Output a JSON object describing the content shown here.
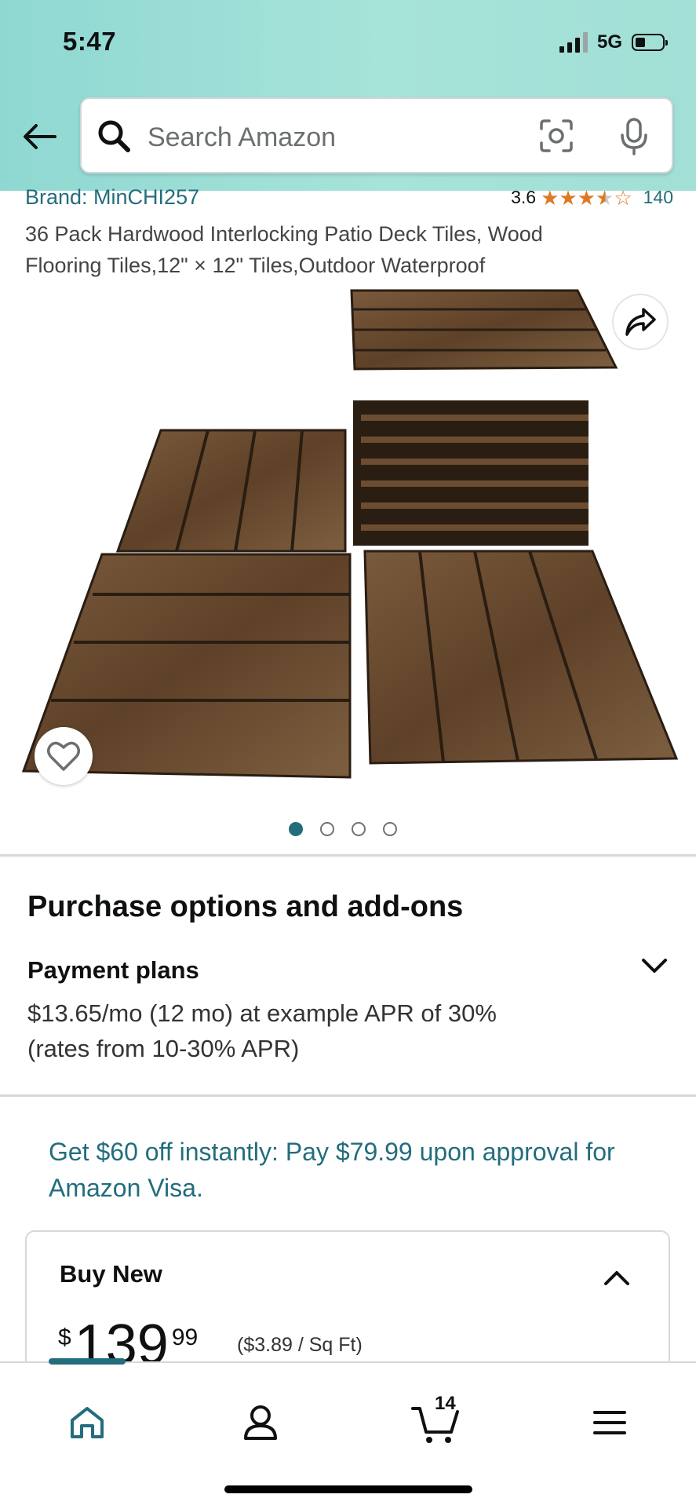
{
  "status_bar": {
    "time": "5:47",
    "network": "5G"
  },
  "search": {
    "placeholder": "Search Amazon"
  },
  "product": {
    "brand": "Brand: MinCHI257",
    "rating_value": "3.6",
    "rating_stars": 3.6,
    "rating_count": "140",
    "title": "36 Pack Hardwood Interlocking Patio Deck Tiles, Wood Flooring Tiles,12\" × 12\" Tiles,Outdoor Waterproof",
    "image_count": 4,
    "active_image_index": 0
  },
  "purchase_options": {
    "section_title": "Purchase options and add-ons",
    "payment_plans_title": "Payment plans",
    "payment_plans_desc": "$13.65/mo (12 mo) at example APR of 30% (rates from 10-30% APR)"
  },
  "promo": {
    "text": "Get $60 off instantly: Pay $79.99 upon approval for Amazon Visa."
  },
  "buy_new": {
    "title": "Buy New",
    "currency": "$",
    "price_whole": "139",
    "price_cents": "99",
    "unit_price": "($3.89 / Sq Ft)"
  },
  "bottom_nav": {
    "cart_count": "14",
    "items": [
      "home-icon",
      "account-icon",
      "cart-icon",
      "menu-icon"
    ]
  },
  "colors": {
    "accent_teal": "#236d7d",
    "star_orange": "#de7921",
    "header_gradient_start": "#8fd8d2",
    "header_gradient_end": "#a2dfd6"
  }
}
